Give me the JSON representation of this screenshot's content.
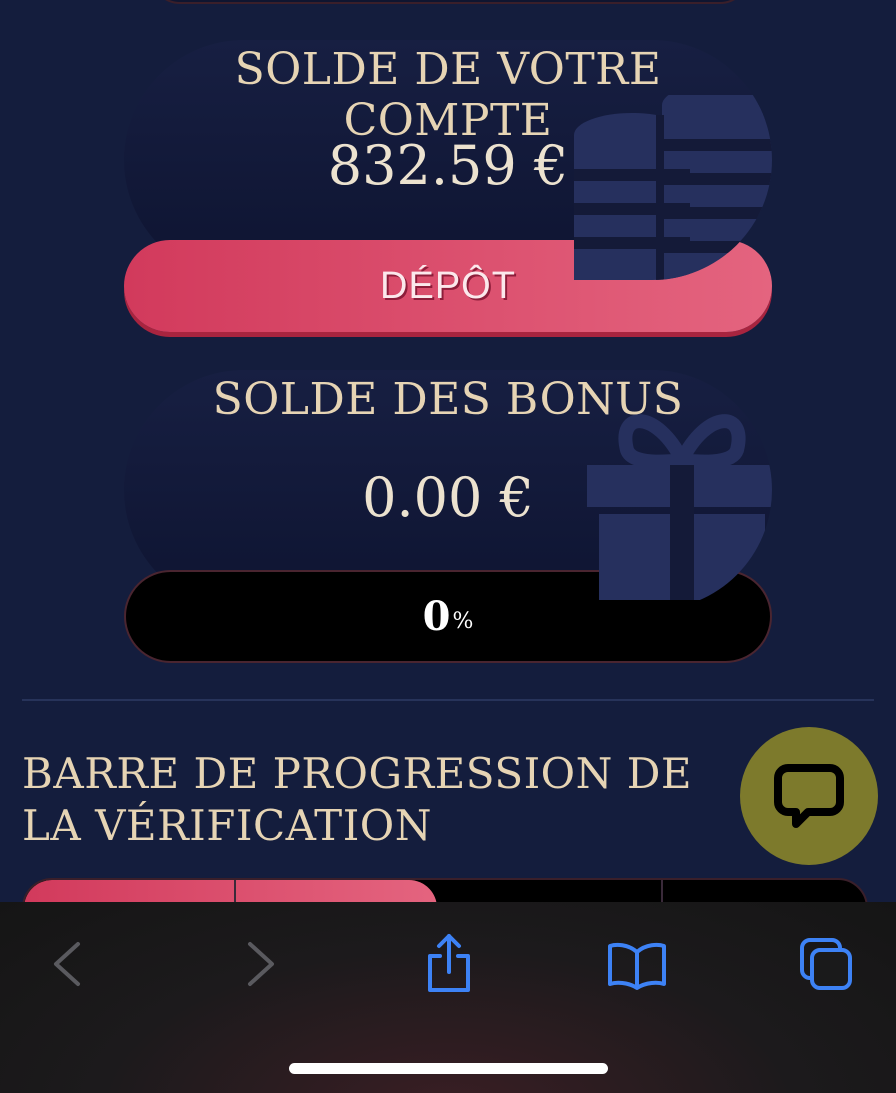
{
  "account": {
    "title": "SOLDE DE VOTRE COMPTE",
    "amount": "832.59 €",
    "deposit_label": "DÉPÔT"
  },
  "bonus": {
    "title": "SOLDE DES BONUS",
    "amount": "0.00 €",
    "progress_value": "0",
    "progress_unit": "%"
  },
  "verification": {
    "title": "BARRE DE PROGRESSION DE LA VÉRIFICATION",
    "progress_fraction": 0.49
  },
  "chat": {
    "icon": "chat-bubble-icon"
  },
  "browser_toolbar": {
    "icons": [
      "back-icon",
      "forward-icon",
      "share-icon",
      "bookmarks-icon",
      "tabs-icon"
    ]
  },
  "colors": {
    "background": "#141d3d",
    "accent": "#d23a5c",
    "gold_text": "#e6d4b4",
    "chat_button": "#7d7a2c",
    "browser_icon": "#3d82f5"
  }
}
